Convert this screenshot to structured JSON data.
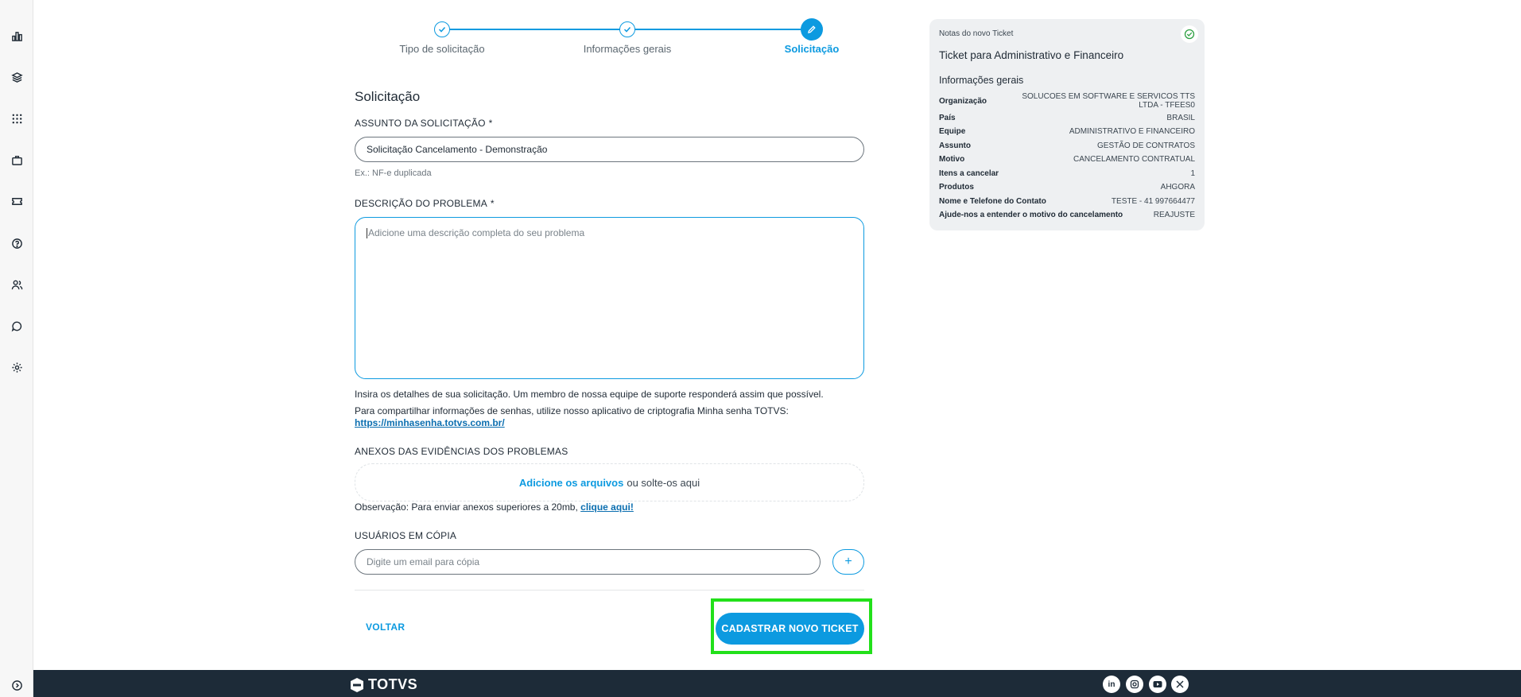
{
  "sidebar": {
    "icons": [
      "dashboard-icon",
      "layers-icon",
      "apps-grid-icon",
      "briefcase-icon",
      "ticket-icon",
      "help-icon",
      "users-icon",
      "chat-icon",
      "settings-icon",
      "expand-icon"
    ]
  },
  "stepper": {
    "steps": [
      {
        "label": "Tipo de solicitação",
        "state": "done"
      },
      {
        "label": "Informações gerais",
        "state": "done"
      },
      {
        "label": "Solicitação",
        "state": "active"
      }
    ]
  },
  "form": {
    "section_title": "Solicitação",
    "subject_label": "ASSUNTO DA SOLICITAÇÃO",
    "required_mark": "*",
    "subject_value": "Solicitação Cancelamento - Demonstração",
    "subject_hint": "Ex.: NF-e duplicada",
    "description_label": "DESCRIÇÃO DO PROBLEMA",
    "description_placeholder": "Adicione uma descrição completa do seu problema",
    "info_line1": "Insira os detalhes de sua solicitação. Um membro de nossa equipe de suporte responderá assim que possível.",
    "info_line2": "Para compartilhar informações de senhas, utilize nosso aplicativo de criptografia Minha senha TOTVS:",
    "info_link": "https://minhasenha.totvs.com.br/",
    "attachments_label": "ANEXOS DAS EVIDÊNCIAS DOS PROBLEMAS",
    "attachments_add": "Adicione os arquivos",
    "attachments_drop": "ou solte-os aqui",
    "attachments_note": "Observação: Para enviar anexos superiores a 20mb,",
    "attachments_note_link": "clique aqui!",
    "cc_label": "USUÁRIOS EM CÓPIA",
    "cc_placeholder": "Digite um email para cópia",
    "cc_add": "+",
    "back_label": "VOLTAR",
    "submit_label": "CADASTRAR NOVO TICKET"
  },
  "notes": {
    "header": "Notas do novo Ticket",
    "title": "Ticket para Administrativo e Financeiro",
    "subtitle": "Informações gerais",
    "rows": [
      {
        "key": "Organização",
        "value": "SOLUCOES EM SOFTWARE E SERVICOS TTS LTDA - TFEES0"
      },
      {
        "key": "País",
        "value": "BRASIL"
      },
      {
        "key": "Equipe",
        "value": "ADMINISTRATIVO E FINANCEIRO"
      },
      {
        "key": "Assunto",
        "value": "GESTÃO DE CONTRATOS"
      },
      {
        "key": "Motivo",
        "value": "CANCELAMENTO CONTRATUAL"
      },
      {
        "key": "Itens a cancelar",
        "value": "1"
      },
      {
        "key": "Produtos",
        "value": "AHGORA"
      },
      {
        "key": "Nome e Telefone do Contato",
        "value": "TESTE - 41 997664477"
      },
      {
        "key": "Ajude-nos a entender o motivo do cancelamento",
        "value": "REAJUSTE"
      }
    ]
  },
  "footer": {
    "brand": "TOTVS",
    "social": [
      "in",
      "ig",
      "yt",
      "x"
    ]
  },
  "colors": {
    "accent": "#0c9ae0",
    "highlight": "#22e01a",
    "footer": "#1d2b38"
  }
}
